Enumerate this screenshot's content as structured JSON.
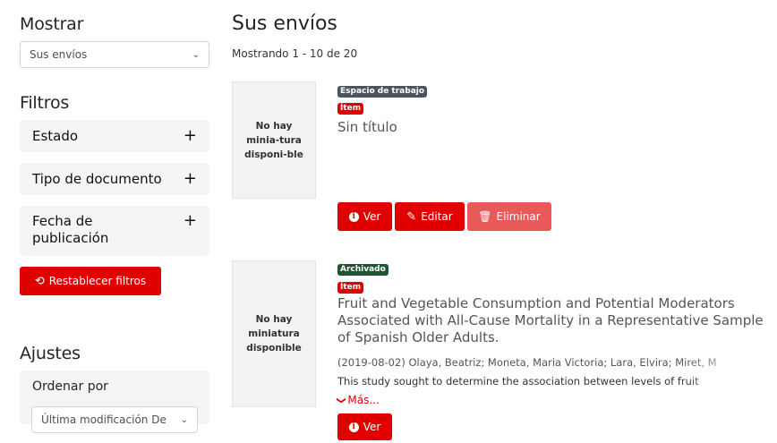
{
  "sidebar": {
    "show_heading": "Mostrar",
    "show_select_value": "Sus envíos",
    "filters_heading": "Filtros",
    "filters": [
      {
        "label": "Estado"
      },
      {
        "label": "Tipo de documento"
      },
      {
        "label": "Fecha de publicación"
      }
    ],
    "reset_label": "Restablecer filtros",
    "settings_heading": "Ajustes",
    "sort_label": "Ordenar por",
    "sort_select_value": "Última modificación De"
  },
  "main": {
    "title": "Sus envíos",
    "count": "Mostrando 1 - 10 de 20",
    "items": [
      {
        "thumbnail": "No hay minia-tura disponi-ble",
        "badges": [
          "Espacio de trabajo",
          "Ítem"
        ],
        "title": "Sin título",
        "actions": {
          "view": "Ver",
          "edit": "Editar",
          "delete": "Eliminar"
        }
      },
      {
        "thumbnail": "No hay miniatura disponible",
        "badges": [
          "Archivado",
          "Ítem"
        ],
        "title": "Fruit and Vegetable Consumption and Potential Moderators Associated with All-Cause Mortality in a Representative Sample of Spanish Older Adults.",
        "meta": "(2019-08-02) Olaya, Beatriz; Moneta, Maria Victoria; Lara, Elvira; Miret, M",
        "abstract": "This study sought to determine the association between levels of fruit",
        "more": "Más...",
        "actions": {
          "view": "Ver"
        }
      }
    ]
  },
  "colors": {
    "primary": "#e00000",
    "danger_light": "#e85a5a",
    "badge_workspace": "#4a5560",
    "badge_archived": "#1e5631"
  }
}
